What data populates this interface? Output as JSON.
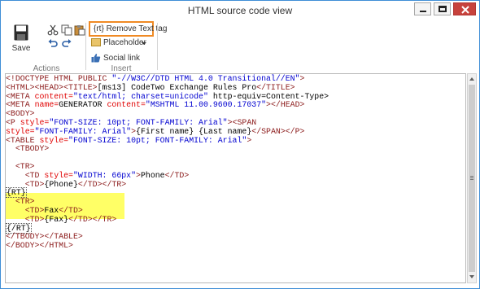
{
  "window": {
    "title": "HTML source code view"
  },
  "ribbon": {
    "save_label": "Save",
    "actions_group": "Actions",
    "insert_group": "Insert",
    "remove_text_tag_label": "{rt} Remove Text tag",
    "placeholder_label": "Placeholder",
    "social_link_label": "Social link"
  },
  "icons": {
    "save": "floppy-disk",
    "cut": "scissors",
    "copy": "copy",
    "paste": "clipboard",
    "undo": "undo-arrow",
    "redo": "redo-arrow",
    "placeholder": "placeholder-tag",
    "social_link": "thumbs-up"
  },
  "colors": {
    "accent_border": "#3f8ed6",
    "highlight": "#ffff66",
    "rt_button_border": "#f08a24",
    "close_button": "#c7423c"
  },
  "code": {
    "lines": [
      [
        {
          "t": "<!DOCTYPE HTML PUBLIC ",
          "c": "tag"
        },
        {
          "t": "\"-//W3C//DTD HTML 4.0 Transitional//EN\"",
          "c": "val"
        },
        {
          "t": ">",
          "c": "tag"
        }
      ],
      [
        {
          "t": "<HTML><HEAD><TITLE>",
          "c": "tag"
        },
        {
          "t": "[ms13] CodeTwo Exchange Rules Pro",
          "c": "txt"
        },
        {
          "t": "</TITLE>",
          "c": "tag"
        }
      ],
      [
        {
          "t": "<META ",
          "c": "tag"
        },
        {
          "t": "content=",
          "c": "attr"
        },
        {
          "t": "\"text/html; charset=unicode\"",
          "c": "val"
        },
        {
          "t": " http-equiv=Content-Type>",
          "c": "txt"
        }
      ],
      [
        {
          "t": "<META ",
          "c": "tag"
        },
        {
          "t": "name=",
          "c": "attr"
        },
        {
          "t": "GENERATOR ",
          "c": "txt"
        },
        {
          "t": "content=",
          "c": "attr"
        },
        {
          "t": "\"MSHTML 11.00.9600.17037\"",
          "c": "val"
        },
        {
          "t": "></HEAD>",
          "c": "tag"
        }
      ],
      [
        {
          "t": "<BODY>",
          "c": "tag"
        }
      ],
      [
        {
          "t": "<P ",
          "c": "tag"
        },
        {
          "t": "style=",
          "c": "attr"
        },
        {
          "t": "\"FONT-SIZE: 10pt; FONT-FAMILY: Arial\"",
          "c": "val"
        },
        {
          "t": "><SPAN",
          "c": "tag"
        }
      ],
      [
        {
          "t": "style=",
          "c": "attr"
        },
        {
          "t": "\"FONT-FAMILY: Arial\"",
          "c": "val"
        },
        {
          "t": ">",
          "c": "tag"
        },
        {
          "t": "{First name} {Last name}",
          "c": "txt"
        },
        {
          "t": "</SPAN></P>",
          "c": "tag"
        }
      ],
      [
        {
          "t": "<TABLE ",
          "c": "tag"
        },
        {
          "t": "style=",
          "c": "attr"
        },
        {
          "t": "\"FONT-SIZE: 10pt; FONT-FAMILY: Arial\"",
          "c": "val"
        },
        {
          "t": ">",
          "c": "tag"
        }
      ],
      [
        {
          "t": "  <TBODY>",
          "c": "tag"
        }
      ],
      [
        {
          "t": "",
          "c": "txt"
        }
      ],
      [
        {
          "t": "  <TR>",
          "c": "tag"
        }
      ],
      [
        {
          "t": "    <TD ",
          "c": "tag"
        },
        {
          "t": "style=",
          "c": "attr"
        },
        {
          "t": "\"WIDTH: 66px\"",
          "c": "val"
        },
        {
          "t": ">",
          "c": "tag"
        },
        {
          "t": "Phone",
          "c": "txt"
        },
        {
          "t": "</TD>",
          "c": "tag"
        }
      ],
      [
        {
          "t": "    <TD>",
          "c": "tag"
        },
        {
          "t": "{Phone}",
          "c": "txt"
        },
        {
          "t": "</TD></TR>",
          "c": "tag"
        }
      ],
      [
        {
          "t": "{RT}",
          "c": "rt"
        }
      ],
      [
        {
          "t": "  <TR>",
          "c": "tag"
        }
      ],
      [
        {
          "t": "    <TD>",
          "c": "tag"
        },
        {
          "t": "Fax",
          "c": "txt"
        },
        {
          "t": "</TD>",
          "c": "tag"
        }
      ],
      [
        {
          "t": "    <TD>",
          "c": "tag"
        },
        {
          "t": "{Fax}",
          "c": "txt"
        },
        {
          "t": "</TD></TR>",
          "c": "tag"
        }
      ],
      [
        {
          "t": "{/RT}",
          "c": "rt"
        }
      ],
      [
        {
          "t": "</TBODY></TABLE>",
          "c": "tag"
        }
      ],
      [
        {
          "t": "</BODY></HTML>",
          "c": "tag"
        }
      ]
    ],
    "highlighted_lines": [
      14,
      15,
      16
    ]
  }
}
